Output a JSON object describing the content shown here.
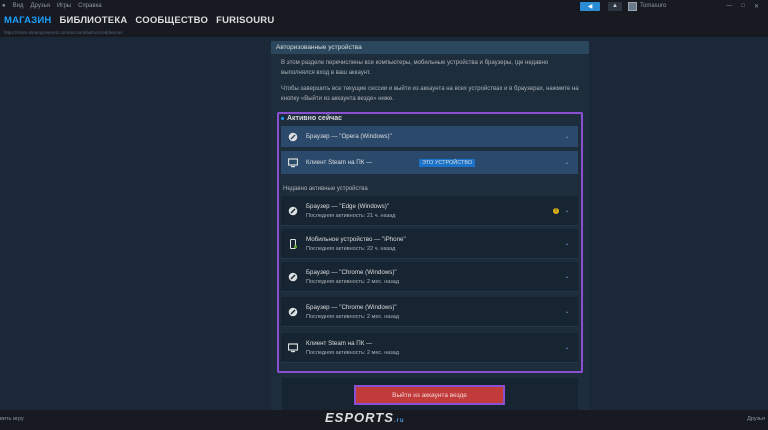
{
  "menubar": {
    "items": [
      "Вид",
      "Друзья",
      "Игры",
      "Справка"
    ],
    "username": "Tomasuro"
  },
  "nav": {
    "items": [
      "МАГАЗИН",
      "БИБЛИОТЕКА",
      "СООБЩЕСТВО",
      "FURISOURU"
    ]
  },
  "url": "https://store.steampowered.com/account/authorizeddevices",
  "panel": {
    "header": "Авторизованные устройства",
    "desc1": "В этом разделе перечислены все компьютеры, мобильные устройства и браузеры, где недавно выполнялся вход в ваш аккаунт.",
    "desc2": "Чтобы завершить все текущие сессии и выйти из аккаунта на всех устройствах и в браузерах, нажмите на кнопку «Выйти из аккаунта везде» ниже.",
    "active_title": "Активно сейчас",
    "recent_title": "Недавно активные устройства",
    "this_device_badge": "ЭТО УСТРОЙСТВО",
    "active_devices": [
      {
        "name": "Браузер — \"Opera (Windows)\"",
        "icon": "browser-icon"
      },
      {
        "name": "Клиент Steam на ПК —",
        "icon": "monitor-icon"
      }
    ],
    "recent_devices": [
      {
        "name": "Браузер — \"Edge (Windows)\"",
        "sub": "Последняя активность: 21 ч. назад",
        "icon": "browser-icon"
      },
      {
        "name": "Мобильное устройство — \"iPhone\"",
        "sub": "Последняя активность: 22 ч. назад",
        "icon": "phone-icon"
      },
      {
        "name": "Браузер — \"Chrome (Windows)\"",
        "sub": "Последняя активность: 2 мес. назад",
        "icon": "browser-icon"
      },
      {
        "name": "Браузер — \"Chrome (Windows)\"",
        "sub": "Последняя активность: 2 мес. назад",
        "icon": "browser-icon"
      },
      {
        "name": "Клиент Steam на ПК —",
        "sub": "Последняя активность: 2 мес. назад",
        "icon": "monitor-icon"
      }
    ],
    "signout_label": "Выйти из аккаунта везде"
  },
  "bottom": {
    "left": "вить игру",
    "right": "Друзья",
    "watermark": "ESPORTS",
    "watermark_sub": ".ru"
  },
  "colors": {
    "accent": "#1a9fff",
    "highlight": "#8b4fd1",
    "danger": "#c23b3b"
  }
}
